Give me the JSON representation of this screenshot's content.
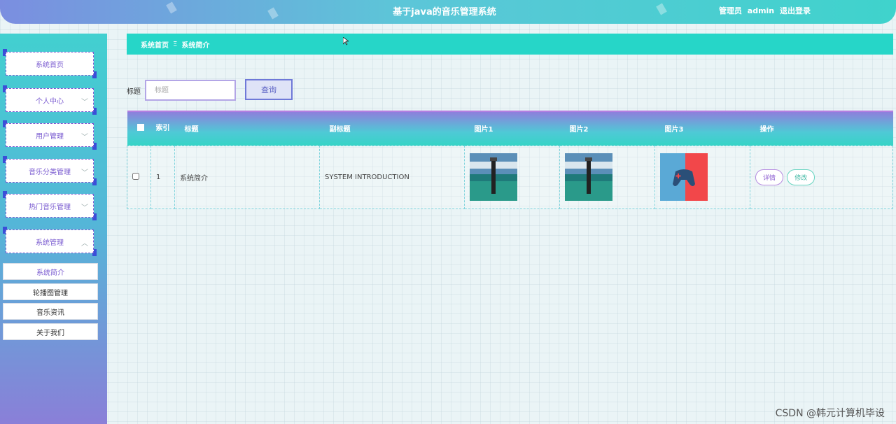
{
  "header": {
    "title": "基于java的音乐管理系统",
    "role": "管理员",
    "username": "admin",
    "logout": "退出登录"
  },
  "sidebar": {
    "items": [
      {
        "label": "系统首页",
        "icon": "none"
      },
      {
        "label": "个人中心",
        "icon": "chevron-down-icon"
      },
      {
        "label": "用户管理",
        "icon": "chevron-down-icon"
      },
      {
        "label": "音乐分类管理",
        "icon": "chevron-down-icon"
      },
      {
        "label": "热门音乐管理",
        "icon": "chevron-down-icon"
      },
      {
        "label": "系统管理",
        "icon": "chevron-up-icon"
      }
    ],
    "sub_items": [
      {
        "label": "系统简介",
        "active": true
      },
      {
        "label": "轮播图管理",
        "active": false
      },
      {
        "label": "音乐资讯",
        "active": false
      },
      {
        "label": "关于我们",
        "active": false
      }
    ]
  },
  "breadcrumb": {
    "home": "系统首页",
    "separator": "Ξ",
    "current": "系统简介"
  },
  "search": {
    "label": "标题",
    "placeholder": "标题",
    "button": "查询"
  },
  "table": {
    "headers": [
      "索引",
      "标题",
      "副标题",
      "图片1",
      "图片2",
      "图片3",
      "操作"
    ],
    "rows": [
      {
        "index": "1",
        "title": "系统简介",
        "subtitle": "SYSTEM INTRODUCTION",
        "actions": {
          "detail": "详情",
          "edit": "修改"
        }
      }
    ]
  },
  "colors": {
    "accent": "#26d6c8",
    "purple": "#7a5bd0",
    "header_start": "#7b8ee0",
    "header_end": "#3fd3cc"
  },
  "watermark": "CSDN @韩元计算机毕设"
}
